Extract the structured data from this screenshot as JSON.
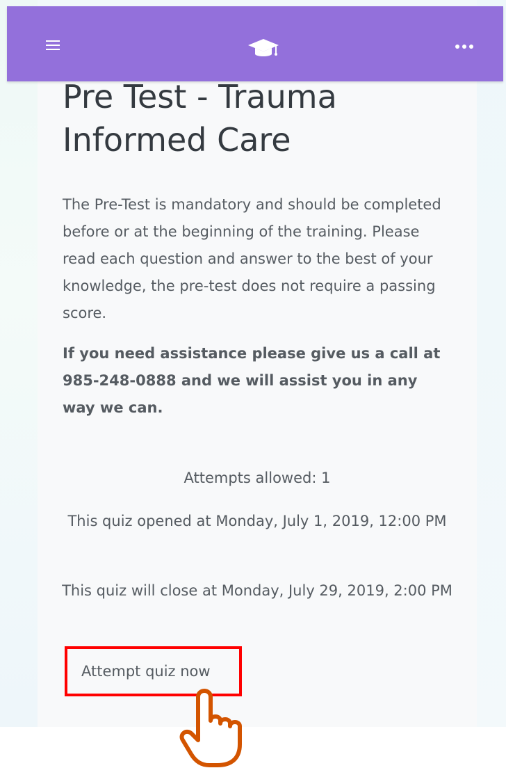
{
  "navbar": {
    "background": "#9370db",
    "menu_icon": "hamburger-menu-icon",
    "logo_icon": "graduation-cap-icon",
    "more_icon": "more-dots-icon"
  },
  "page": {
    "title": "Pre Test - Trauma Informed Care",
    "intro": "The Pre-Test is mandatory and should be completed before or at the beginning of the training.  Please read each question and answer to the best of your knowledge, the pre-test does not require a passing score.",
    "help": "If you need assistance please give us a call at 985-248-0888 and we will assist you in any way we can."
  },
  "quiz": {
    "attempts": "Attempts allowed: 1",
    "opened": "This quiz opened at Monday, July 1, 2019, 12:00 PM",
    "closes": "This quiz will close at Monday, July 29, 2019, 2:00 PM",
    "attempt_button": "Attempt quiz now",
    "highlight_color": "#ff0000"
  },
  "overlay": {
    "pointer_icon": "hand-pointer-icon",
    "pointer_color": "#d35400"
  }
}
